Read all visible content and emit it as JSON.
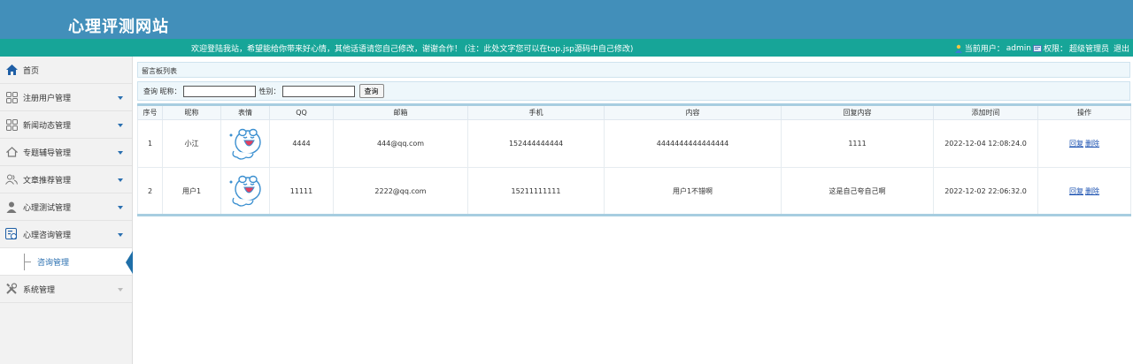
{
  "header": {
    "site_title": "心理评测网站",
    "notice": "欢迎登陆我站，希望能给你带来好心情，其他话语请您自己修改，谢谢合作！ (注：此处文字您可以在top.jsp源码中自己修改)",
    "current_user_label": "当前用户：",
    "current_user": "admin",
    "permission_label": "权限：",
    "permission": "超级管理员",
    "logout": "退出"
  },
  "sidebar": {
    "items": [
      {
        "label": "首页",
        "icon": "home-icon"
      },
      {
        "label": "注册用户管理",
        "icon": "grid-icon"
      },
      {
        "label": "新闻动态管理",
        "icon": "grid-icon"
      },
      {
        "label": "专题辅导管理",
        "icon": "home-outline-icon"
      },
      {
        "label": "文章推荐管理",
        "icon": "users-icon"
      },
      {
        "label": "心理测试管理",
        "icon": "person-icon"
      },
      {
        "label": "心理咨询管理",
        "icon": "consult-icon"
      },
      {
        "label": "系统管理",
        "icon": "tools-icon"
      }
    ],
    "sub_item": "咨询管理"
  },
  "main": {
    "panel_title": "留言板列表",
    "search": {
      "query_label": "查询 昵称：",
      "gender_label": "性别：",
      "button": "查询",
      "nickname_value": "",
      "gender_value": ""
    },
    "table": {
      "headers": [
        "序号",
        "昵称",
        "表情",
        "QQ",
        "邮箱",
        "手机",
        "内容",
        "回复内容",
        "添加时间",
        "操作"
      ],
      "rows": [
        {
          "no": "1",
          "nickname": "小江",
          "qq": "4444",
          "email": "444@qq.com",
          "phone": "152444444444",
          "content": "4444444444444444",
          "reply": "1111",
          "time": "2022-12-04 12:08:24.0",
          "reply_link": "回复",
          "delete_link": "删除"
        },
        {
          "no": "2",
          "nickname": "用户1",
          "qq": "11111",
          "email": "2222@qq.com",
          "phone": "15211111111",
          "content": "用户1不错啊",
          "reply": "这是自己夸自己啊",
          "time": "2022-12-02 22:06:32.0",
          "reply_link": "回复",
          "delete_link": "删除"
        }
      ]
    }
  },
  "colors": {
    "header_bg": "#428fba",
    "notice_bg": "#17a598",
    "link": "#1a50b0",
    "active_arrow": "#1f6fa8"
  }
}
